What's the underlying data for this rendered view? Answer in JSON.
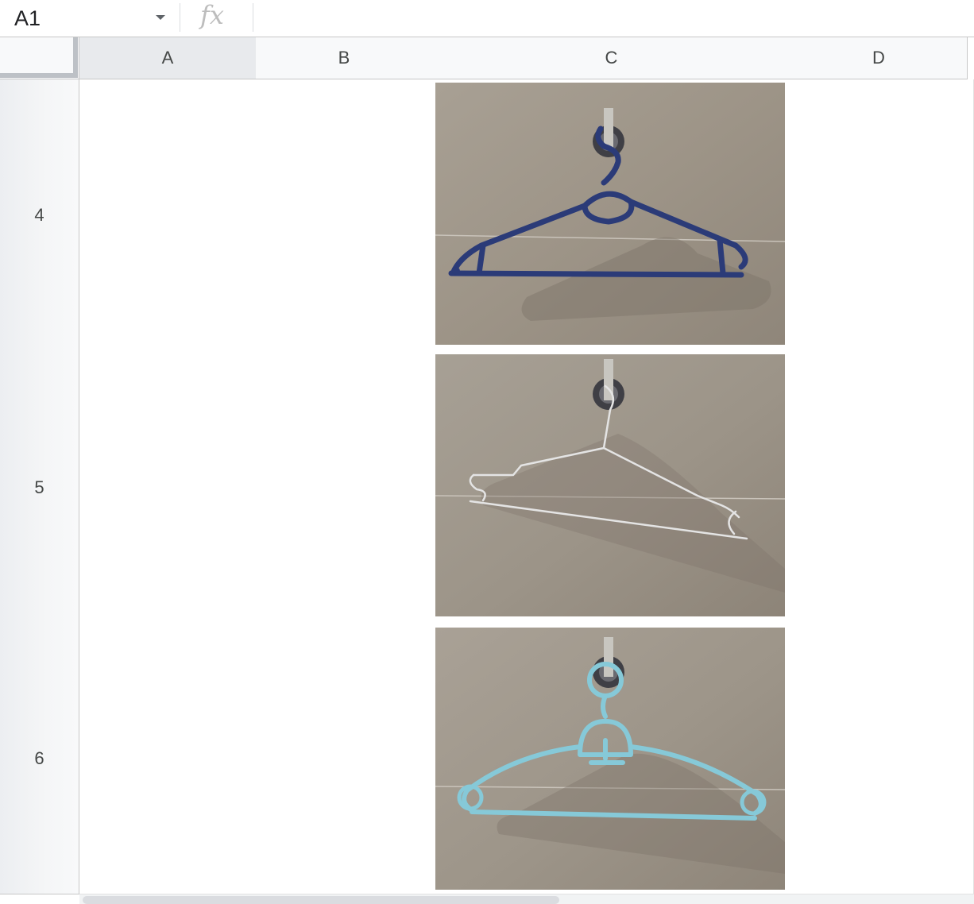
{
  "formula_bar": {
    "name_box": "A1",
    "fx_label": "fx",
    "formula": ""
  },
  "columns": [
    "A",
    "B",
    "C",
    "D"
  ],
  "rows": [
    "4",
    "5",
    "6"
  ],
  "images": [
    {
      "row": "4",
      "column": "C",
      "hanger_color": "#2b3b78",
      "description": "navy hanger"
    },
    {
      "row": "5",
      "column": "C",
      "hanger_color": "#dcdcdc",
      "description": "wire hanger"
    },
    {
      "row": "6",
      "column": "C",
      "hanger_color": "#86c9d8",
      "description": "light-blue hanger"
    }
  ],
  "colors": {
    "wall": "#9c9286",
    "header_bg": "#f8f9fa",
    "selected_header_bg": "#e8eaed",
    "gridline": "#e2e2e2"
  }
}
